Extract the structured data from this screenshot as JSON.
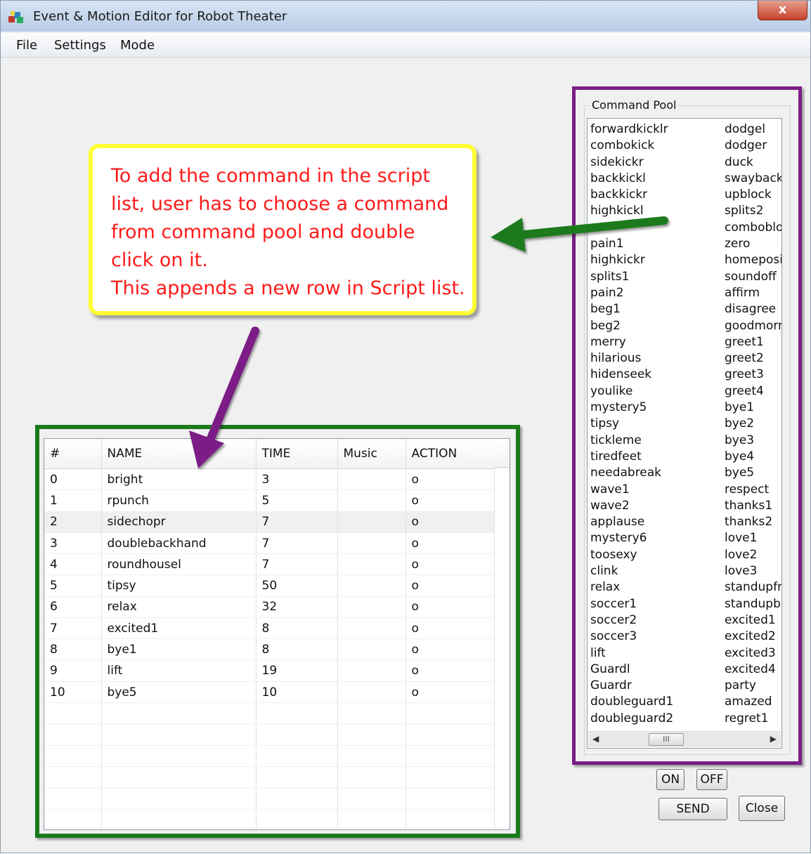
{
  "window": {
    "title": "Event & Motion Editor for Robot Theater",
    "close_label": "x"
  },
  "menu": {
    "items": [
      "File",
      "Settings",
      "Mode"
    ]
  },
  "callout": {
    "lines": [
      "To add the command in the script",
      "list, user has to choose a command",
      "from command pool and double",
      "click on it.",
      "This appends a new row in Script list."
    ],
    "text_color": "#ff1a1a",
    "border_color": "#ffff33"
  },
  "command_pool": {
    "title": "Command Pool",
    "frame_color": "#7b1d86",
    "column1": [
      "forwardkicklr",
      "combokick",
      "sidekickr",
      "backkickl",
      "backkickr",
      "highkickl",
      "",
      "pain1",
      "highkickr",
      "splits1",
      "pain2",
      "beg1",
      "beg2",
      "merry",
      "hilarious",
      "hidenseek",
      "youlike",
      "mystery5",
      "tipsy",
      "tickleme",
      "tiredfeet",
      "needabreak",
      "wave1",
      "wave2",
      "applause",
      "mystery6",
      "toosexy",
      "clink",
      "relax",
      "soccer1",
      "soccer2",
      "soccer3",
      "lift",
      "Guardl",
      "Guardr",
      "doubleguard1",
      "doubleguard2"
    ],
    "column2": [
      "dodgel",
      "dodger",
      "duck",
      "swayback",
      "upblock",
      "splits2",
      "combobloc",
      "zero",
      "homeposit",
      "soundoff",
      "affirm",
      "disagree",
      "goodmorni",
      "greet1",
      "greet2",
      "greet3",
      "greet4",
      "bye1",
      "bye2",
      "bye3",
      "bye4",
      "bye5",
      "respect",
      "thanks1",
      "thanks2",
      "love1",
      "love2",
      "love3",
      "standupfr",
      "standupba",
      "excited1",
      "excited2",
      "excited3",
      "excited4",
      "party",
      "amazed",
      "regret1"
    ],
    "scroll_thumb": "III"
  },
  "buttons": {
    "on": "ON",
    "off": "OFF",
    "send": "SEND",
    "close": "Close"
  },
  "script_table": {
    "frame_color": "#1b7a1b",
    "columns": [
      "#",
      "NAME",
      "TIME",
      "Music",
      "ACTION"
    ],
    "rows": [
      [
        "0",
        "bright",
        "3",
        "",
        "o"
      ],
      [
        "1",
        "rpunch",
        "5",
        "",
        "o"
      ],
      [
        "2",
        "sidechopr",
        "7",
        "",
        "o"
      ],
      [
        "3",
        "doublebackhand",
        "7",
        "",
        "o"
      ],
      [
        "4",
        "roundhousel",
        "7",
        "",
        "o"
      ],
      [
        "5",
        "tipsy",
        "50",
        "",
        "o"
      ],
      [
        "6",
        "relax",
        "32",
        "",
        "o"
      ],
      [
        "7",
        "excited1",
        "8",
        "",
        "o"
      ],
      [
        "8",
        "bye1",
        "8",
        "",
        "o"
      ],
      [
        "9",
        "lift",
        "19",
        "",
        "o"
      ],
      [
        "10",
        "bye5",
        "10",
        "",
        "o"
      ]
    ],
    "selected_row": 2,
    "empty_rows": 6
  },
  "arrows": {
    "green": "#1e7a1e",
    "purple": "#7b1d86"
  }
}
